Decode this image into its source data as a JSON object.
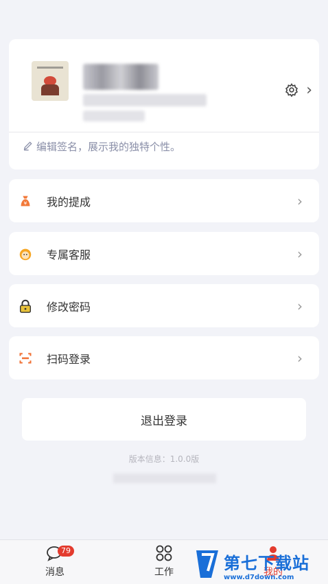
{
  "profile": {
    "signature": "编辑签名，展示我的独特个性。"
  },
  "menu": [
    {
      "label": "我的提成",
      "icon": "money-bag-icon",
      "color": "#f27a3a"
    },
    {
      "label": "专属客服",
      "icon": "customer-service-icon",
      "color": "#f6a623"
    },
    {
      "label": "修改密码",
      "icon": "lock-icon",
      "color": "#b99500"
    },
    {
      "label": "扫码登录",
      "icon": "scan-icon",
      "color": "#f07034"
    }
  ],
  "logout": "退出登录",
  "version": "版本信息：1.0.0版",
  "tabs": [
    {
      "label": "消息",
      "badge": "79",
      "icon": "chat-icon"
    },
    {
      "label": "工作",
      "icon": "grid-icon"
    },
    {
      "label": "我的",
      "icon": "person-icon"
    }
  ],
  "watermark": {
    "title": "第七下载站",
    "url": "www.d7down.com"
  }
}
